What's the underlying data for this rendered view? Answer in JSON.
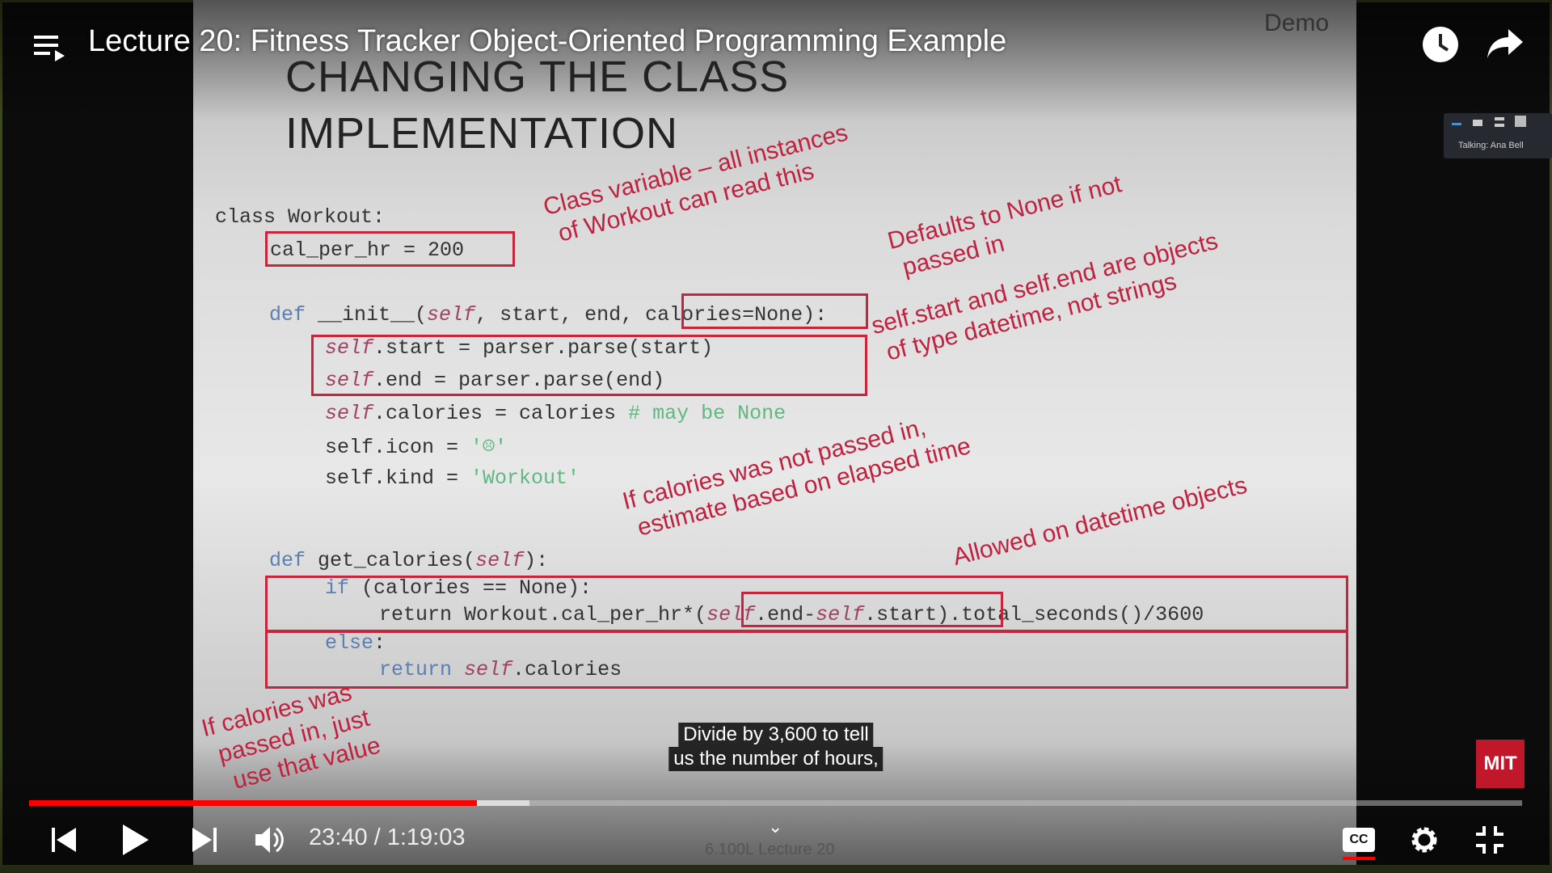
{
  "header": {
    "title": "Lecture 20: Fitness Tracker Object-Oriented Programming Example",
    "watch_later_icon": "clock-icon",
    "share_icon": "share-icon"
  },
  "slide": {
    "tag": "Demo",
    "heading": [
      "CHANGING THE CLASS",
      "IMPLEMENTATION"
    ],
    "code": {
      "l1": "class Workout:",
      "l2": "cal_per_hr = 200",
      "l3a": "def",
      "l3b": " __init__(",
      "l3c": "self",
      "l3d": ", start, end, ",
      "l3e": "calories=None",
      "l3f": "):",
      "l4a": "self",
      "l4b": ".start = parser.parse(start)",
      "l5a": "self",
      "l5b": ".end = parser.parse(end)",
      "l6a": "self",
      "l6b": ".calories = calories ",
      "l6c": "# may be None",
      "l7a": "self.icon = ",
      "l7b": "'☹'",
      "l8a": "self.kind = ",
      "l8b": "'Workout'",
      "l9a": "def",
      "l9b": " get_calories(",
      "l9c": "self",
      "l9d": "):",
      "l10a": "if",
      "l10b": " (calories == None):",
      "l11a": "return Workout.cal_per_hr*(",
      "l11b": "self",
      "l11c": ".end-",
      "l11d": "self",
      "l11e": ".start",
      ").total_seconds()/3600": "",
      "l11f": ").total_seconds()/3600",
      "l12a": "else",
      ":": "",
      "l12b": ":",
      "l13a": "return ",
      "l13b": "self",
      "l13c": ".calories"
    },
    "annotations": {
      "a1": "Class variable – all instances",
      "a1b": "of Workout can read this",
      "a2": "Defaults to None if not",
      "a2b": "passed in",
      "a3": "self.start and self.end are objects",
      "a3b": "of type datetime, not strings",
      "a4": "If calories was not passed in,",
      "a4b": "estimate based on elapsed time",
      "a5": "Allowed on datetime objects",
      "a6": "If calories was",
      "a6b": "passed in, just",
      "a6c": "use that value"
    },
    "footer": "6.100L Lecture 20"
  },
  "zoom_panel": {
    "label": "Talking: Ana Bell"
  },
  "captions": [
    "Divide by 3,600 to tell",
    "us the number of hours,"
  ],
  "player": {
    "time": "23:40 / 1:19:03",
    "progress_percent": 30.0,
    "buffered_percent": 33.5,
    "accent": "#ff0000",
    "brand_logo": "MIT"
  }
}
